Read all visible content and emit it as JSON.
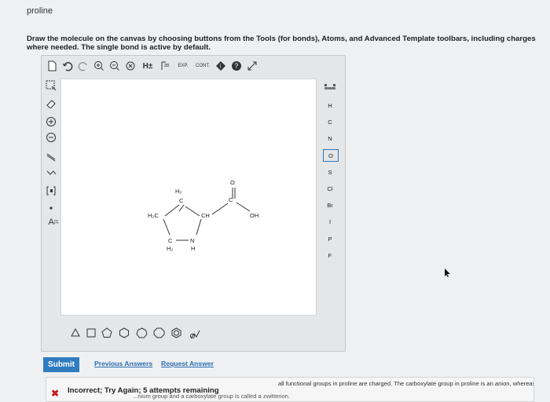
{
  "question": {
    "title": "proline",
    "instructions": "Draw the molecule on the canvas by choosing buttons from the Tools (for bonds), Atoms, and Advanced Template toolbars, including charges where needed. The single bond is active by default."
  },
  "toolbar_top": {
    "h_plus": "H±",
    "exp_label": "EXP.",
    "cont_label": "CONT."
  },
  "toolbar_left": {
    "charge_label": "[1]",
    "atom_a_label": "A"
  },
  "atoms": [
    "H",
    "C",
    "N",
    "O",
    "S",
    "Cl",
    "Br",
    "I",
    "P",
    "F"
  ],
  "active_atom": "O",
  "molecule": {
    "h2_top": "H₂",
    "c_top": "C",
    "h3c_left": "H₂C",
    "ch": "CH",
    "c_carbonyl": "C",
    "o_double": "O",
    "oh": "OH",
    "c_bottom": "C",
    "h2_bottom": "H₂",
    "n": "N",
    "h_n": "H"
  },
  "actions": {
    "submit": "Submit",
    "previous_answers": "Previous Answers",
    "request_answer": "Request Answer"
  },
  "feedback": {
    "status": "Incorrect; Try Again; 5 attempts remaining",
    "detail_line1": "all functional groups in proline are charged. The carboxylate group in proline is an anion, whereas the amine groups are",
    "detail_line2": "...nium group and a carboxylate group is called a zwitterion."
  },
  "colors": {
    "accent": "#2f7cc1",
    "error": "#c62020",
    "link": "#2b6db3"
  }
}
